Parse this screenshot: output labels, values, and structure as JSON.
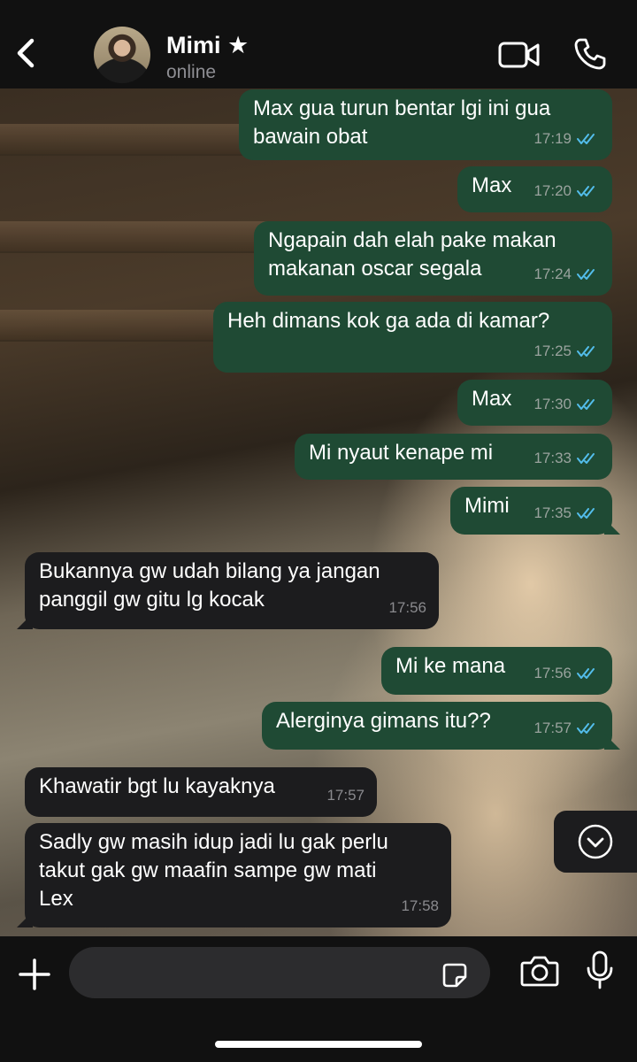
{
  "header": {
    "contact_name": "Mimi ★",
    "status": "online"
  },
  "messages": [
    {
      "dir": "out",
      "text": "Max gua turun bentar lgi ini gua\nbawain obat",
      "time": "17:19",
      "read": true
    },
    {
      "dir": "out",
      "text": "Max",
      "time": "17:20",
      "read": true
    },
    {
      "dir": "out",
      "text": "Ngapain dah elah pake makan\nmakanan oscar segala",
      "time": "17:24",
      "read": true
    },
    {
      "dir": "out",
      "text": "Heh dimans kok ga ada di kamar?",
      "time": "17:25",
      "read": true
    },
    {
      "dir": "out",
      "text": "Max",
      "time": "17:30",
      "read": true
    },
    {
      "dir": "out",
      "text": "Mi nyaut kenape mi",
      "time": "17:33",
      "read": true
    },
    {
      "dir": "out",
      "text": "Mimi",
      "time": "17:35",
      "read": true
    },
    {
      "dir": "in",
      "text": "Bukannya gw udah bilang ya jangan\npanggil gw gitu lg kocak",
      "time": "17:56"
    },
    {
      "dir": "out",
      "text": "Mi ke mana",
      "time": "17:56",
      "read": true
    },
    {
      "dir": "out",
      "text": "Alerginya gimans itu??",
      "time": "17:57",
      "read": true
    },
    {
      "dir": "in",
      "text": "Khawatir bgt lu kayaknya",
      "time": "17:57"
    },
    {
      "dir": "in",
      "text": "Sadly gw masih idup jadi lu gak perlu\ntakut gak gw maafin sampe gw mati\nLex",
      "time": "17:58"
    }
  ],
  "composer": {
    "placeholder": ""
  },
  "icons": {
    "back": "chevron-left-icon",
    "video": "video-camera-icon",
    "call": "phone-icon",
    "scroll": "chevron-down-circle-icon",
    "plus": "plus-icon",
    "sticker": "sticker-icon",
    "camera": "camera-icon",
    "mic": "microphone-icon"
  },
  "colors": {
    "outgoing_bubble": "#1f4a34",
    "incoming_bubble": "#1c1c1e",
    "read_ticks": "#53bdeb"
  }
}
